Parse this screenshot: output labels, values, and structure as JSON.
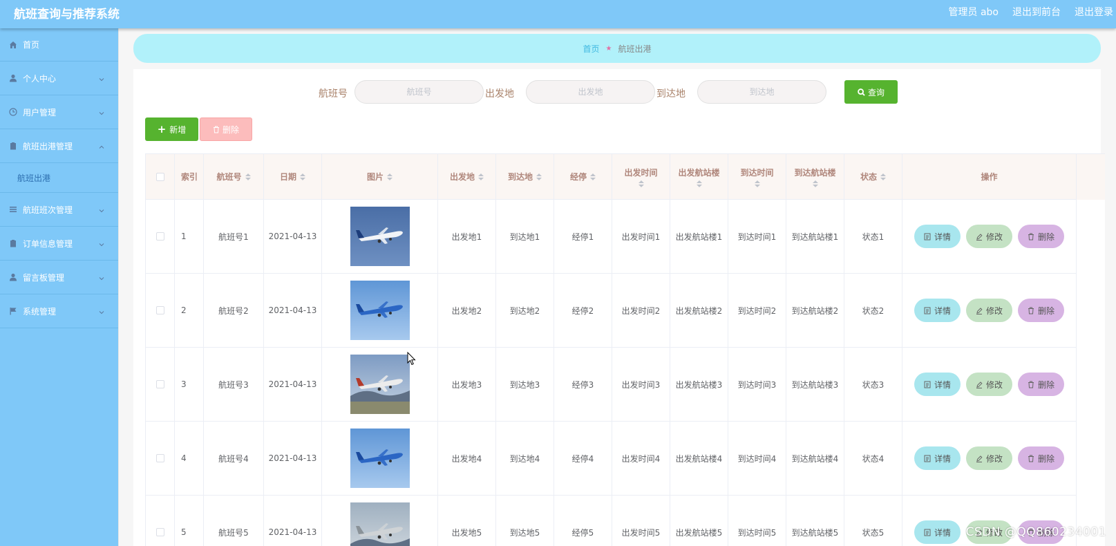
{
  "app": {
    "title": "航班查询与推荐系统"
  },
  "header": {
    "user": "管理员 abo",
    "front": "退出到前台",
    "logout": "退出登录"
  },
  "sidebar": {
    "items": [
      {
        "label": "首页",
        "icon": "home-icon"
      },
      {
        "label": "个人中心",
        "icon": "user-icon"
      },
      {
        "label": "用户管理",
        "icon": "clock-icon"
      },
      {
        "label": "航班出港管理",
        "icon": "clipboard-icon",
        "expanded": true
      },
      {
        "label": "航班出港",
        "icon": "",
        "sub": true
      },
      {
        "label": "航班班次管理",
        "icon": "list-icon"
      },
      {
        "label": "订单信息管理",
        "icon": "clipboard-icon"
      },
      {
        "label": "留言板管理",
        "icon": "user-icon"
      },
      {
        "label": "系统管理",
        "icon": "flag-icon"
      }
    ]
  },
  "breadcrumb": {
    "home": "首页",
    "current": "航班出港"
  },
  "search": {
    "flight_label": "航班号",
    "flight_placeholder": "航班号",
    "from_label": "出发地",
    "from_placeholder": "出发地",
    "to_label": "到达地",
    "to_placeholder": "到达地",
    "query_label": "查询"
  },
  "toolbar": {
    "add_label": "新增",
    "delete_label": "删除"
  },
  "table": {
    "columns": [
      "索引",
      "航班号",
      "日期",
      "图片",
      "出发地",
      "到达地",
      "经停",
      "出发时间",
      "出发航站楼",
      "到达时间",
      "到达航站楼",
      "状态",
      "操作"
    ],
    "actions": {
      "detail": "详情",
      "edit": "修改",
      "delete": "删除"
    },
    "rows": [
      {
        "index": "1",
        "flight": "航班号1",
        "date": "2021-04-13",
        "from": "出发地1",
        "to": "到达地1",
        "stop": "经停1",
        "dep_time": "出发时间1",
        "dep_terminal": "出发航站楼1",
        "arr_time": "到达时间1",
        "arr_terminal": "到达航站楼1",
        "status": "状态1"
      },
      {
        "index": "2",
        "flight": "航班号2",
        "date": "2021-04-13",
        "from": "出发地2",
        "to": "到达地2",
        "stop": "经停2",
        "dep_time": "出发时间2",
        "dep_terminal": "出发航站楼2",
        "arr_time": "到达时间2",
        "arr_terminal": "到达航站楼2",
        "status": "状态2"
      },
      {
        "index": "3",
        "flight": "航班号3",
        "date": "2021-04-13",
        "from": "出发地3",
        "to": "到达地3",
        "stop": "经停3",
        "dep_time": "出发时间3",
        "dep_terminal": "出发航站楼3",
        "arr_time": "到达时间3",
        "arr_terminal": "到达航站楼3",
        "status": "状态3"
      },
      {
        "index": "4",
        "flight": "航班号4",
        "date": "2021-04-13",
        "from": "出发地4",
        "to": "到达地4",
        "stop": "经停4",
        "dep_time": "出发时间4",
        "dep_terminal": "出发航站楼4",
        "arr_time": "到达时间4",
        "arr_terminal": "到达航站楼4",
        "status": "状态4"
      },
      {
        "index": "5",
        "flight": "航班号5",
        "date": "2021-04-13",
        "from": "出发地5",
        "to": "到达地5",
        "stop": "经停5",
        "dep_time": "出发时间5",
        "dep_terminal": "出发航站楼5",
        "arr_time": "到达时间5",
        "arr_terminal": "到达航站楼5",
        "status": "状态5"
      }
    ]
  },
  "watermark": "CSDN @QQ860234001",
  "colors": {
    "topbar": "#7fc8f8",
    "breadcrumb_bg": "#b1f1fa",
    "green": "#56b32f",
    "header_text": "#b0877c"
  }
}
